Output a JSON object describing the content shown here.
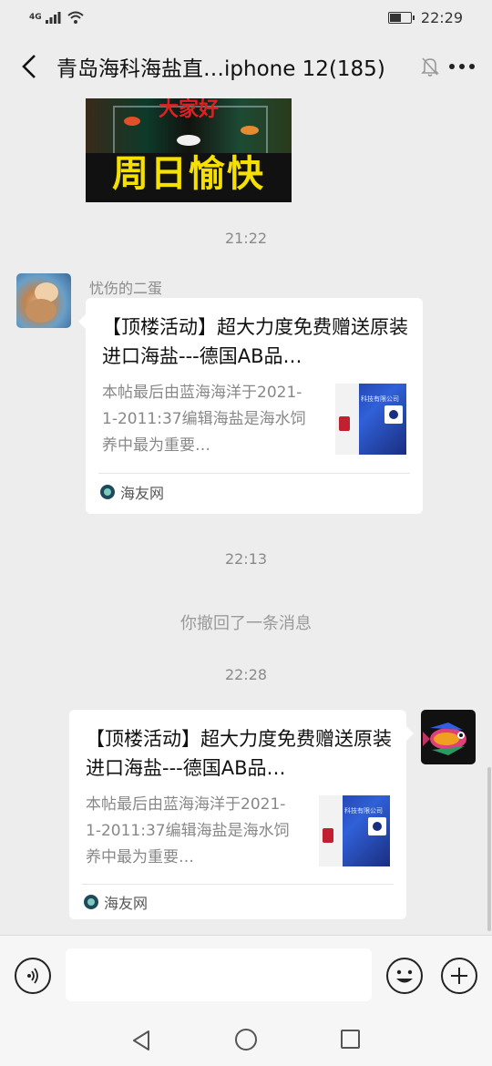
{
  "status_bar": {
    "network_label": "4G",
    "time": "22:29",
    "battery_level": 0.55
  },
  "header": {
    "title": "青岛海科海盐直…iphone 12(185)",
    "back_icon": "chevron-left-icon",
    "mute_icon": "bell-off-icon",
    "more_icon": "more-dots-icon"
  },
  "chat": {
    "image_message": {
      "top_text": "大家好",
      "main_text": "周日愉快"
    },
    "timestamps": [
      "21:22",
      "22:13",
      "22:28"
    ],
    "recall_notice": "你撤回了一条消息",
    "messages": [
      {
        "sender": "忧伤的二蛋",
        "card": {
          "title": "【顶楼活动】超大力度免费赠送原装进口海盐---德国AB品…",
          "description": "本帖最后由蓝海海洋于2021-1-2011:37编辑海盐是海水饲养中最为重要…",
          "thumbnail_caption": "科技有限公司",
          "source": "海友网"
        }
      },
      {
        "sender": "",
        "card": {
          "title": "【顶楼活动】超大力度免费赠送原装进口海盐---德国AB品…",
          "description": "本帖最后由蓝海海洋于2021-1-2011:37编辑海盐是海水饲养中最为重要…",
          "thumbnail_caption": "科技有限公司",
          "source": "海友网"
        }
      }
    ]
  },
  "input_bar": {
    "voice_icon": "voice-icon",
    "placeholder": "",
    "emoji_icon": "emoji-icon",
    "plus_icon": "plus-icon"
  },
  "nav_bar": {
    "back_icon": "nav-back-icon",
    "home_icon": "nav-home-icon",
    "recent_icon": "nav-recent-icon"
  }
}
